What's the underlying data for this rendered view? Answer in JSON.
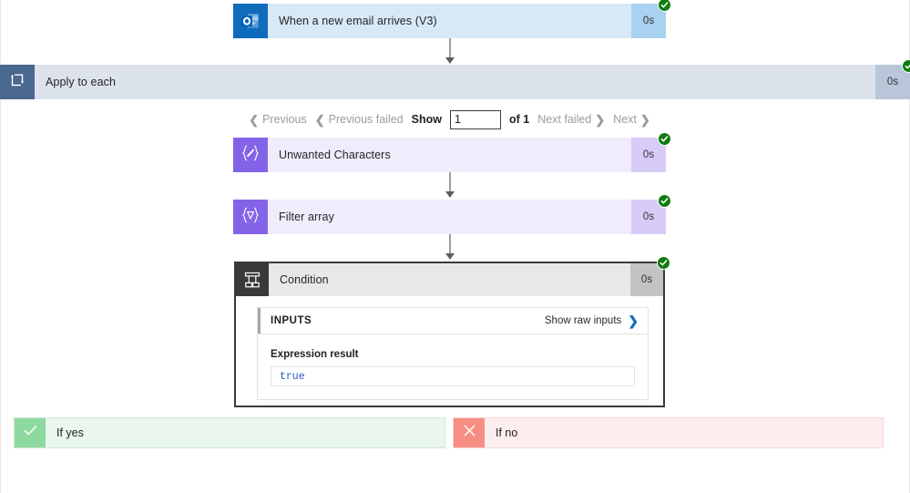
{
  "flow": {
    "trigger": {
      "title": "When a new email arrives (V3)",
      "duration": "0s",
      "icon": "outlook-icon",
      "status": "succeeded"
    },
    "loop": {
      "title": "Apply to each",
      "duration": "0s",
      "icon": "loop-icon",
      "status": "succeeded"
    },
    "pagination": {
      "previous_label": "Previous",
      "previous_failed_label": "Previous failed",
      "show_label": "Show",
      "page_value": "1",
      "page_placeholder": "1",
      "of_label": "of 1",
      "next_failed_label": "Next failed",
      "next_label": "Next"
    },
    "actions": [
      {
        "title": "Unwanted Characters",
        "duration": "0s",
        "icon": "compose-icon",
        "status": "succeeded"
      },
      {
        "title": "Filter array",
        "duration": "0s",
        "icon": "filter-array-icon",
        "status": "succeeded"
      }
    ],
    "condition": {
      "title": "Condition",
      "duration": "0s",
      "icon": "condition-branch-icon",
      "status": "succeeded",
      "inputs_panel": {
        "header_label": "INPUTS",
        "raw_inputs_link": "Show raw inputs",
        "expression_label": "Expression result",
        "expression_value": "true"
      },
      "branches": [
        {
          "label": "If yes",
          "icon": "check-icon"
        },
        {
          "label": "If no",
          "icon": "cross-icon"
        }
      ]
    }
  },
  "colors": {
    "trigger_bg": "#d7e9f7",
    "trigger_icon_bg": "#0f6cbd",
    "loop_bg": "#dde3ec",
    "loop_icon_bg": "#4a6790",
    "action_bg": "#f0ecfc",
    "action_icon_bg": "#8364e8",
    "condition_bg": "#e8e8e8",
    "condition_icon_bg": "#393939",
    "success_badge": "#107c10",
    "branch_yes": "#8ed99f",
    "branch_no": "#f78e84",
    "link_accent": "#0f6cbd",
    "expression_text": "#2b56c4"
  }
}
